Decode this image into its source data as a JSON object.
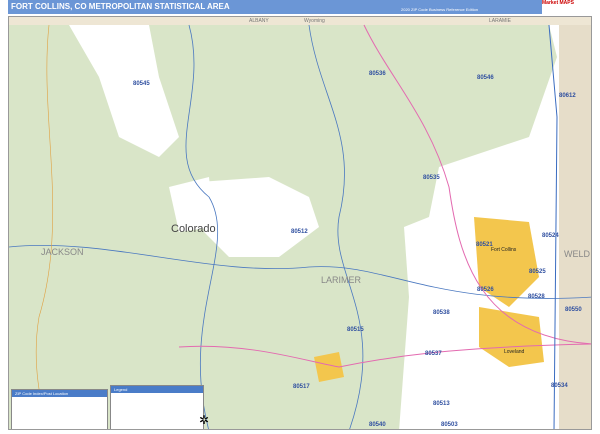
{
  "header": {
    "title": "FORT COLLINS, CO METROPOLITAN STATISTICAL AREA",
    "edition": "2020 ZIP Code Business Reference Edition",
    "logo": "Market MAPS"
  },
  "edges": {
    "top": [
      "ALBANY",
      "Wyoming",
      "LARAMIE"
    ]
  },
  "counties": [
    "JACKSON",
    "LARIMER",
    "WELD"
  ],
  "state": "Colorado",
  "cities": [
    "Fort Collins",
    "Loveland"
  ],
  "zips": [
    "80545",
    "80536",
    "80546",
    "80612",
    "80535",
    "80524",
    "80512",
    "80521",
    "80525",
    "80528",
    "80526",
    "80538",
    "80550",
    "80515",
    "80537",
    "80534",
    "80517",
    "80513",
    "80540",
    "80503"
  ],
  "legend": {
    "zip_index_title": "ZIP Code Index/Post Location",
    "legend_title": "Legend"
  },
  "colors": {
    "forest": "#d9e5c8",
    "private": "#ffffff",
    "weld": "#e6ddc9",
    "urban": "#f3c64d",
    "water": "#9cc8ea",
    "highway": "#e36ab0",
    "title_bar": "#6b96d6"
  }
}
